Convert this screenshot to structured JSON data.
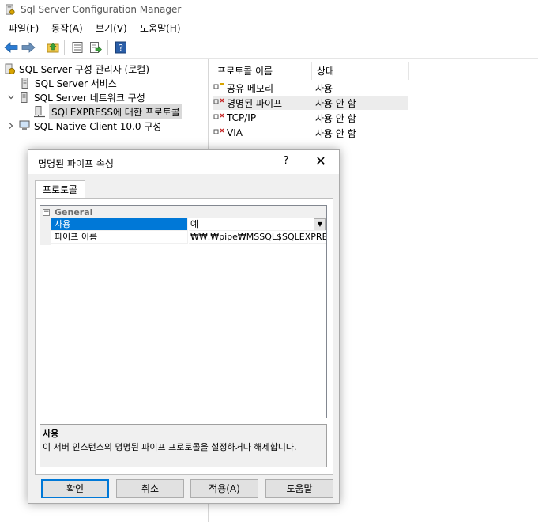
{
  "window": {
    "title": "Sql Server Configuration Manager"
  },
  "menu": [
    "파일(F)",
    "동작(A)",
    "보기(V)",
    "도움말(H)"
  ],
  "toolbar": {
    "buttons": [
      "back-arrow-icon",
      "forward-arrow-icon",
      "up-folder-icon",
      "properties-icon",
      "export-icon",
      "help-icon"
    ],
    "help_glyph": "?"
  },
  "tree": {
    "root": "SQL Server 구성 관리자 (로컬)",
    "items": [
      {
        "label": "SQL Server 서비스"
      },
      {
        "label": "SQL Server 네트워크 구성"
      },
      {
        "label": "SQLEXPRESS에 대한 프로토콜"
      },
      {
        "label": "SQL Native Client 10.0 구성"
      }
    ]
  },
  "protocols": {
    "columns": [
      "프로토콜 이름",
      "상태"
    ],
    "rows": [
      {
        "name": "공유 메모리",
        "status": "사용"
      },
      {
        "name": "명명된 파이프",
        "status": "사용 안 함"
      },
      {
        "name": "TCP/IP",
        "status": "사용 안 함"
      },
      {
        "name": "VIA",
        "status": "사용 안 함"
      }
    ]
  },
  "dialog": {
    "title": "명명된 파이프 속성",
    "help": "?",
    "close": "✕",
    "tab": "프로토콜",
    "category": "General",
    "category_toggle": "−",
    "properties": [
      {
        "name": "사용",
        "value": "예"
      },
      {
        "name": "파이프 이름",
        "value": "₩₩.₩pipe₩MSSQL$SQLEXPRESS₩"
      }
    ],
    "dropdown_glyph": "▼",
    "description_title": "사용",
    "description_text": "이 서버 인스턴스의 명명된 파이프 프로토콜을 설정하거나 해제합니다.",
    "buttons": {
      "ok": "확인",
      "cancel": "취소",
      "apply": "적용(A)",
      "help": "도움말"
    }
  },
  "colors": {
    "accent": "#0078d7",
    "selection": "#0078d7",
    "back_arrow": "#2a7bd3",
    "forward_arrow": "#6a8fb8"
  }
}
